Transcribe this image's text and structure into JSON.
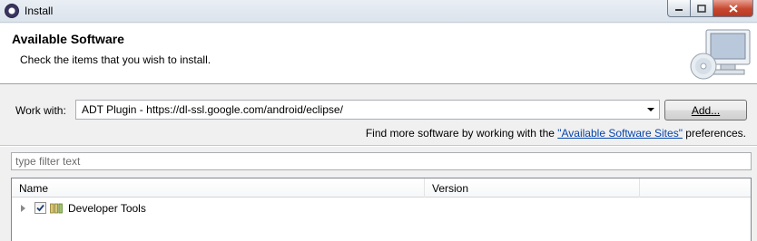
{
  "window": {
    "title": "Install",
    "controls": {
      "minimize_icon": "minimize-icon",
      "maximize_icon": "maximize-icon",
      "close_icon": "close-icon"
    }
  },
  "header": {
    "title": "Available Software",
    "description": "Check the items that you wish to install."
  },
  "work_with": {
    "label": "Work with:",
    "value": "ADT Plugin - https://dl-ssl.google.com/android/eclipse/",
    "add_label": "Add..."
  },
  "find_more": {
    "prefix": "Find more software by working with the ",
    "link": "\"Available Software Sites\"",
    "suffix": " preferences."
  },
  "filter": {
    "placeholder": "type filter text"
  },
  "tree": {
    "columns": [
      "Name",
      "Version",
      ""
    ],
    "items": [
      {
        "label": "Developer Tools",
        "checked": true,
        "expanded": false,
        "version": ""
      }
    ]
  },
  "colors": {
    "link": "#0645ad",
    "close_button": "#c7472f"
  }
}
